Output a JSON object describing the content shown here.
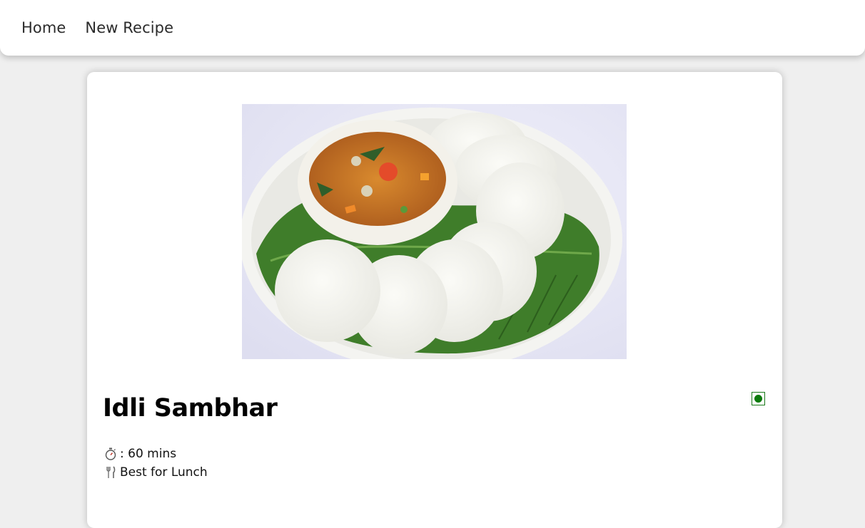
{
  "nav": {
    "home": "Home",
    "new_recipe": "New Recipe"
  },
  "recipe": {
    "title": "Idli Sambhar",
    "time_label": ": 60 mins",
    "meal_label": "Best for Lunch",
    "veg_indicator_color": "#0b7a0b"
  },
  "icons": {
    "time": "stopwatch-icon",
    "meal": "fork-knife-icon",
    "veg": "veg-indicator-icon"
  }
}
